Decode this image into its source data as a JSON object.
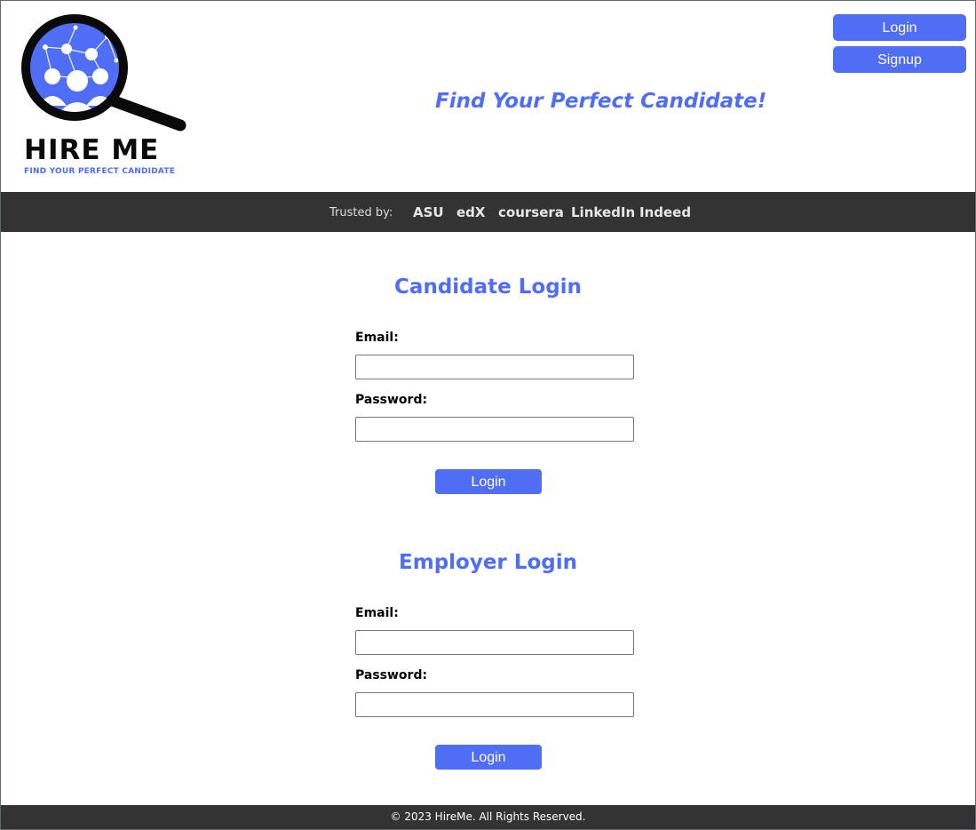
{
  "brand": {
    "logo_title": "HIRE ME",
    "logo_subtitle": "FIND YOUR PERFECT CANDIDATE",
    "tagline": "Find Your Perfect Candidate!",
    "accent_color": "#4f6df5"
  },
  "header": {
    "login_label": "Login",
    "signup_label": "Signup"
  },
  "trusted": {
    "label": "Trusted by:",
    "brands": [
      "ASU",
      "edX",
      "coursera",
      "LinkedIn",
      "Indeed"
    ]
  },
  "candidate": {
    "title": "Candidate Login",
    "email_label": "Email:",
    "email_value": "",
    "password_label": "Password:",
    "password_value": "",
    "button_label": "Login"
  },
  "employer": {
    "title": "Employer Login",
    "email_label": "Email:",
    "email_value": "",
    "password_label": "Password:",
    "password_value": "",
    "button_label": "Login"
  },
  "footer": {
    "text": "© 2023 HireMe. All Rights Reserved."
  },
  "icons": {
    "logo": "magnifier-people-network-icon"
  }
}
